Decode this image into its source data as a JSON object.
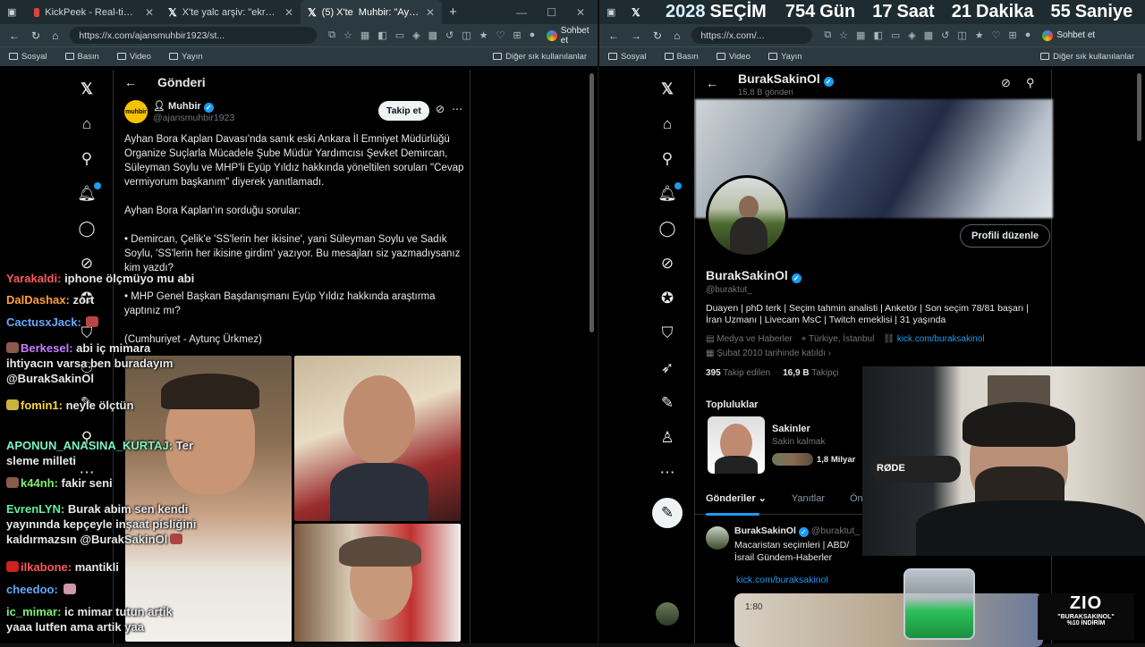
{
  "left_window": {
    "tabs": [
      {
        "title": "KickPeek - Real-time URL Crawler"
      },
      {
        "title": "X'te yalc arşiv: \"ekrem papazoğlu"
      },
      {
        "title": "(5) X'te",
        "title2": "Muhbir: \"Ayhan Bora"
      }
    ],
    "url": "https://x.com/ajansmuhbir1923/st...",
    "chat_button": "Sohbet et",
    "bookmarks": [
      "Sosyal",
      "Basın",
      "Video",
      "Yayın"
    ],
    "bookmarks_other": "Diğer sık kullanılanlar",
    "page_header": "Gönderi",
    "author": {
      "name": "Muhbir",
      "handle": "@ajansmuhbir1923",
      "avatar_text": "muhbir"
    },
    "follow_button": "Takip et",
    "post_paragraphs": [
      "Ayhan Bora Kaplan Davası'nda sanık eski Ankara İl Emniyet Müdürlüğü Organize Suçlarla Mücadele Şube Müdür Yardımcısı Şevket Demircan, Süleyman Soylu ve MHP'li Eyüp Yıldız hakkında yöneltilen soruları \"Cevap vermiyorum başkanım\" diyerek yanıtlamadı.",
      "Ayhan Bora Kaplan'ın sorduğu sorular:",
      "• Demircan, Çelik'e 'SS'lerin her ikisine', yani Süleyman Soylu ve Sadık Soylu, 'SS'lerin her ikisine girdim' yazıyor. Bu mesajları siz yazmadıysanız kim yazdı?",
      "• MHP Genel Başkan Başdanışmanı Eyüp Yıldız hakkında araştırma yaptınız mı?",
      "(Cumhuriyet - Aytunç Ürkmez)"
    ],
    "notif_count": "5"
  },
  "chat": [
    {
      "name": "Yarakaldi:",
      "msg": "iphone ölçmüyo mu abi",
      "color": "#ff5a5a"
    },
    {
      "name": "DalDashax:",
      "msg": "zort",
      "color": "#ff9f43"
    },
    {
      "name": "CactusxJack:",
      "msg": "",
      "color": "#66a8ff"
    },
    {
      "name": "Berkesel:",
      "msg": "abi iç mimara ihtiyacın varsa ben buradayım @BurakSakinOl",
      "color": "#c77dff"
    },
    {
      "name": "fomin1:",
      "msg": "neyle ölçtün",
      "color": "#ffd23f"
    },
    {
      "name": "APONUN_ANASINA_KURTAJ:",
      "msg": "Ter sleme milleti",
      "color": "#7cf3c4"
    },
    {
      "name": "k44nh:",
      "msg": "fakir seni",
      "color": "#7cf36f"
    },
    {
      "name": "EvrenLYN:",
      "msg": "Burak abim sen kendi yayınında kepçeyle inşaat pisliğini kaldırmazsın @BurakSakinOl",
      "color": "#5cf2a0"
    },
    {
      "name": "ilkabone:",
      "msg": "mantikli",
      "color": "#ff5a5a"
    },
    {
      "name": "cheedoo:",
      "msg": "",
      "color": "#66a8ff"
    },
    {
      "name": "ic_mimar:",
      "msg": "ic mimar tutun artik yaaa lutfen ama artik yaa",
      "color": "#7cf36f"
    }
  ],
  "right_window": {
    "timer": {
      "year": "2028",
      "label": "SEÇİM",
      "days": "754",
      "days_unit": "Gün",
      "hours": "17",
      "hours_unit": "Saat",
      "minutes": "21",
      "minutes_unit": "Dakika",
      "seconds": "55",
      "seconds_unit": "Saniye"
    },
    "url": "https://x.com/...",
    "chat_button": "Sohbet et",
    "bookmarks": [
      "Sosyal",
      "Basın",
      "Video",
      "Yayın"
    ],
    "bookmarks_other": "Diğer sık kullanılanlar",
    "profile": {
      "name": "BurakSakinOl",
      "post_count": "15,8 B gönderi",
      "handle": "@buraktut_",
      "edit_button": "Profili düzenle",
      "bio": "Duayen | phD terk | Seçim tahmin analisti | Anketör | Son seçim 78/81 başarı | İran Uzmanı | Livecam MsC | Twitch emeklisi | 31 yaşında",
      "category": "Medya ve Haberler",
      "location": "Türkiye, İstanbul",
      "link": "kick.com/buraksakinol",
      "joined": "Şubat 2010 tarihinde katıldı",
      "following_count": "395",
      "following_label": "Takip edilen",
      "followers_count": "16,9 B",
      "followers_label": "Takipçi",
      "communities_title": "Topluluklar",
      "community_name": "Sakinler",
      "community_desc": "Sakin kalmak",
      "community_members": "1,8 Milyar",
      "tabs": [
        "Gönderiler",
        "Yanıtlar",
        "Öne Çı"
      ],
      "tweet_name": "BurakSakinOl",
      "tweet_handle": "@buraktut_ ·",
      "tweet_text": "Macaristan seçimleri | ABD/İsrail Gündem-Haberler",
      "tweet_link": "kick.com/buraksakinol",
      "video_time": "1:80"
    },
    "notif_count": "5"
  },
  "webcam": {
    "mic_brand": "RØDE"
  },
  "overlay": {
    "logo": "ZIO",
    "promo_line1": "\"BURAKSAKINOL\"",
    "promo_line2": "%10 İNDİRİM"
  }
}
